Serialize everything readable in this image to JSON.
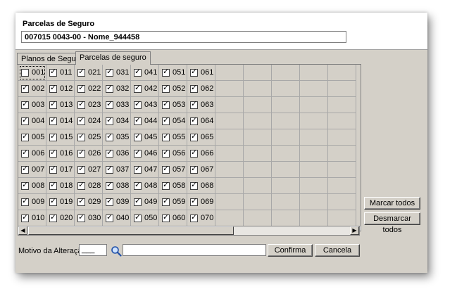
{
  "header": {
    "title": "Parcelas de Seguro",
    "name_value": "007015 0043-00 - Nome_944458"
  },
  "tabs": [
    {
      "label": "Planos de Seguro",
      "active": false
    },
    {
      "label": "Parcelas de seguro",
      "active": true
    }
  ],
  "grid": {
    "columns": [
      {
        "items": [
          {
            "label": "001",
            "checked": false
          },
          {
            "label": "002",
            "checked": true
          },
          {
            "label": "003",
            "checked": true
          },
          {
            "label": "004",
            "checked": true
          },
          {
            "label": "005",
            "checked": true
          },
          {
            "label": "006",
            "checked": true
          },
          {
            "label": "007",
            "checked": true
          },
          {
            "label": "008",
            "checked": true
          },
          {
            "label": "009",
            "checked": true
          },
          {
            "label": "010",
            "checked": true
          }
        ]
      },
      {
        "items": [
          {
            "label": "011",
            "checked": true
          },
          {
            "label": "012",
            "checked": true
          },
          {
            "label": "013",
            "checked": true
          },
          {
            "label": "014",
            "checked": true
          },
          {
            "label": "015",
            "checked": true
          },
          {
            "label": "016",
            "checked": true
          },
          {
            "label": "017",
            "checked": true
          },
          {
            "label": "018",
            "checked": true
          },
          {
            "label": "019",
            "checked": true
          },
          {
            "label": "020",
            "checked": true
          }
        ]
      },
      {
        "items": [
          {
            "label": "021",
            "checked": true
          },
          {
            "label": "022",
            "checked": true
          },
          {
            "label": "023",
            "checked": true
          },
          {
            "label": "024",
            "checked": true
          },
          {
            "label": "025",
            "checked": true
          },
          {
            "label": "026",
            "checked": true
          },
          {
            "label": "027",
            "checked": true
          },
          {
            "label": "028",
            "checked": true
          },
          {
            "label": "029",
            "checked": true
          },
          {
            "label": "030",
            "checked": true
          }
        ]
      },
      {
        "items": [
          {
            "label": "031",
            "checked": true
          },
          {
            "label": "032",
            "checked": true
          },
          {
            "label": "033",
            "checked": true
          },
          {
            "label": "034",
            "checked": true
          },
          {
            "label": "035",
            "checked": true
          },
          {
            "label": "036",
            "checked": true
          },
          {
            "label": "037",
            "checked": true
          },
          {
            "label": "038",
            "checked": true
          },
          {
            "label": "039",
            "checked": true
          },
          {
            "label": "040",
            "checked": true
          }
        ]
      },
      {
        "items": [
          {
            "label": "041",
            "checked": true
          },
          {
            "label": "042",
            "checked": true
          },
          {
            "label": "043",
            "checked": true
          },
          {
            "label": "044",
            "checked": true
          },
          {
            "label": "045",
            "checked": true
          },
          {
            "label": "046",
            "checked": true
          },
          {
            "label": "047",
            "checked": true
          },
          {
            "label": "048",
            "checked": true
          },
          {
            "label": "049",
            "checked": true
          },
          {
            "label": "050",
            "checked": true
          }
        ]
      },
      {
        "items": [
          {
            "label": "051",
            "checked": true
          },
          {
            "label": "052",
            "checked": true
          },
          {
            "label": "053",
            "checked": true
          },
          {
            "label": "054",
            "checked": true
          },
          {
            "label": "055",
            "checked": true
          },
          {
            "label": "056",
            "checked": true
          },
          {
            "label": "057",
            "checked": true
          },
          {
            "label": "058",
            "checked": true
          },
          {
            "label": "059",
            "checked": true
          },
          {
            "label": "060",
            "checked": true
          }
        ]
      },
      {
        "items": [
          {
            "label": "061",
            "checked": true
          },
          {
            "label": "062",
            "checked": true
          },
          {
            "label": "063",
            "checked": true
          },
          {
            "label": "064",
            "checked": true
          },
          {
            "label": "065",
            "checked": true
          },
          {
            "label": "066",
            "checked": true
          },
          {
            "label": "067",
            "checked": true
          },
          {
            "label": "068",
            "checked": true
          },
          {
            "label": "069",
            "checked": true
          },
          {
            "label": "070",
            "checked": true
          }
        ]
      }
    ],
    "empty_columns": 5,
    "rows": 10
  },
  "actions": {
    "mark_all": "Marcar todos",
    "unmark_all": "Desmarcar todos"
  },
  "footer": {
    "reason_label": "Motivo da Alteração:",
    "reason_code_value": "___",
    "reason_text_value": "",
    "confirm": "Confirma",
    "cancel": "Cancela"
  },
  "icons": {
    "search": "search-icon"
  }
}
